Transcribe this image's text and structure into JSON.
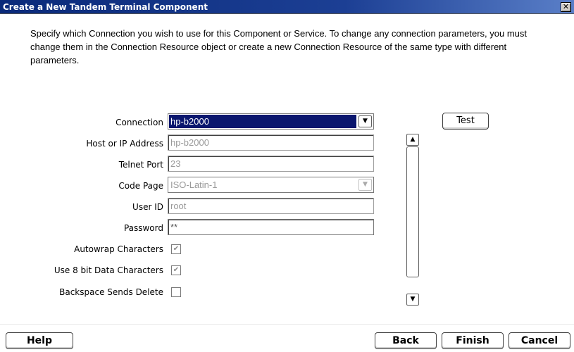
{
  "window": {
    "title": "Create a New Tandem Terminal Component",
    "close_glyph": "✕"
  },
  "description": "Specify which Connection you wish to use for this Component or Service.  To change any connection parameters, you must change them in the Connection Resource object or create a new Connection Resource of the same type with different parameters.",
  "form": {
    "connection": {
      "label": "Connection",
      "value": "hp-b2000"
    },
    "host": {
      "label": "Host or IP Address",
      "value": "hp-b2000"
    },
    "telnet_port": {
      "label": "Telnet Port",
      "value": "23"
    },
    "code_page": {
      "label": "Code Page",
      "value": "ISO-Latin-1"
    },
    "user_id": {
      "label": "User ID",
      "value": "root"
    },
    "password": {
      "label": "Password",
      "value": "**"
    },
    "autowrap": {
      "label": "Autowrap Characters",
      "checked": true
    },
    "eight_bit": {
      "label": "Use 8 bit Data Characters",
      "checked": true
    },
    "backspace": {
      "label": "Backspace Sends Delete",
      "checked": false
    },
    "test_button": "Test"
  },
  "icons": {
    "dropdown": "chevron-down-icon",
    "scroll_up": "chevron-up-icon",
    "scroll_down": "chevron-down-icon",
    "check": "checkmark-icon"
  },
  "glyphs": {
    "down": "▼",
    "up": "▲",
    "check": "✔"
  },
  "buttons": {
    "help": "Help",
    "back": "Back",
    "finish": "Finish",
    "cancel": "Cancel"
  }
}
